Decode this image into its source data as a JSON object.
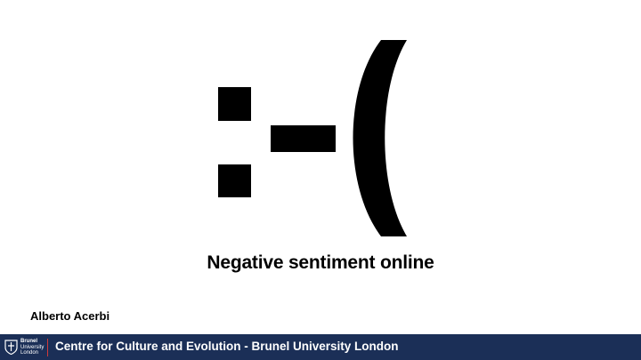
{
  "slide": {
    "emoticon_alt": ":-(",
    "title": "Negative sentiment online",
    "author": "Alberto Acerbi"
  },
  "footer": {
    "logo": {
      "line1": "Brunel",
      "line2": "University",
      "line3": "London"
    },
    "text": "Centre for Culture and Evolution - Brunel University London"
  },
  "colors": {
    "background": "#ffffff",
    "footer_bg": "#1b2f57",
    "text": "#000000",
    "footer_text": "#ffffff",
    "logo_accent": "#d03a3a"
  }
}
